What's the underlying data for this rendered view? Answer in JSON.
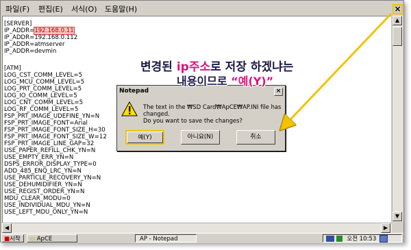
{
  "menu": [
    "파일(F)",
    "편집(E)",
    "서식(O)",
    "도움말(H)"
  ],
  "window_close": "×",
  "editor_lines": [
    "[SERVER]",
    "IP_ADDR=|192.168.0.11",
    "IP_ADDR=192.168.0.112",
    "IP_ADDR=atmserver",
    "IP_ADDR=devmin",
    "",
    "[ATM]",
    "LOG_CST_COMM_LEVEL=5",
    "LOG_MCU_COMM_LEVEL=5",
    "LOG_PRT_COMM_LEVEL=5",
    "LOG_IO_COMM_LEVEL=5",
    "LOG_CNT_COMM_LEVEL=5",
    "LOG_RF_COMM_LEVEL=5",
    "FSP_PRT_IMAGE_UDEFINE_YN=N",
    "FSP_PRT_IMAGE_FONT=Arial",
    "FSP_PRT_IMAGE_FONT_SIZE_H=30",
    "FSP_PRT_IMAGE_FONT_SIZE_W=12",
    "FSP_PRT_IMAGE_LINE_GAP=32",
    "USE_PAPER_REFILL_CHK_YN=N",
    "USE_EMPTY_ERR_YN=N",
    "DSPS_ERROR_DISPLAY_TYPE=0",
    "ADD_485_ENQ_LRC_YN=N",
    "USE_PARTICLE_RECOVERY_YN=N",
    "USE_DEHUMIDIFIER_YN=N",
    "USE_REGIST_ORDER_YN=N",
    "MDU_CLEAR_MODU=0",
    "USE_INDIVIDUAL_MDU_YN=N",
    "USE_LEFT_MDU_ONLY_YN=N"
  ],
  "highlighted_ip": "192.168.0.11",
  "dialog": {
    "title": "Notepad",
    "close": "×",
    "message_1": "The text in the ₩SD Card₩ApCE₩AP.INI file has",
    "message_2": "changed.",
    "message_3": "Do you want to save the changes?",
    "yes": "예(Y)",
    "no": "아니요(N)",
    "cancel": "취소"
  },
  "annotation": {
    "line1_a": "변경된 ",
    "line1_b": "ip주소",
    "line1_c": "로 저장 하겠냐는",
    "line2_a": "내용이므로 ",
    "line2_b": "“예(Y)”"
  },
  "taskbar": {
    "start": "시작",
    "folder": "ApCE",
    "app": "AP - Notepad",
    "time": "오전 10:53"
  },
  "colors": {
    "accent_yellow": "#f2c200",
    "highlight_red": "#e04040",
    "annotation_magenta": "#e0107a",
    "annotation_dark": "#1a1a4a"
  }
}
